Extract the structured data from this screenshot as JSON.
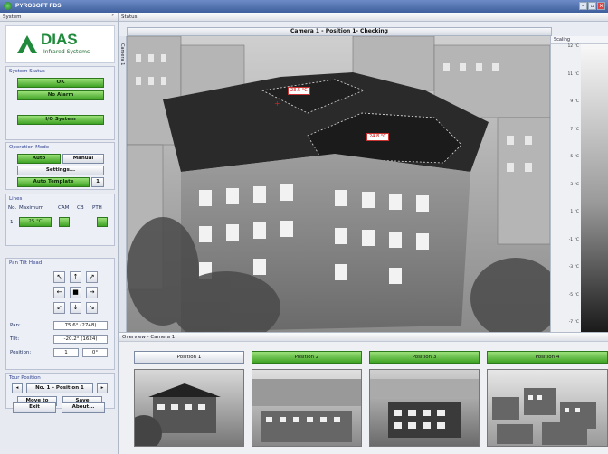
{
  "app": {
    "title": "PYROSOFT FDS"
  },
  "sidebar": {
    "header": "System",
    "logo": {
      "brand": "DIAS",
      "tagline": "Infrared Systems"
    },
    "system_status": {
      "title": "System Status",
      "ok": "OK",
      "alarm": "No Alarm",
      "io": "I/O System"
    },
    "operation_mode": {
      "title": "Operation Mode",
      "auto": "Auto",
      "manual": "Manual",
      "settings": "Settings...",
      "auto_template": "Auto Template",
      "template_no": "1"
    },
    "lines": {
      "title": "Lines",
      "headers": [
        "No.",
        "Maximum",
        "CAM",
        "CB",
        "PTH"
      ],
      "row": {
        "no": "1",
        "maximum": "25 °C"
      }
    },
    "pan_tilt": {
      "title": "Pan Tilt Head",
      "arrows": [
        "↖",
        "↑",
        "↗",
        "←",
        "■",
        "→",
        "↙",
        "↓",
        "↘"
      ],
      "pan_label": "Pan:",
      "pan_value": "75.6° (2748)",
      "tilt_label": "Tilt:",
      "tilt_value": "-20.2° (1624)",
      "position_label": "Position:",
      "position_value": "1",
      "position_deg": "0°"
    },
    "tour": {
      "title": "Tour Position",
      "prev": "◂",
      "current": "No. 1 – Position 1",
      "next": "▸",
      "move_to": "Move to",
      "save": "Save"
    },
    "exit": "Exit",
    "about": "About..."
  },
  "main": {
    "header": "Status",
    "camera_tab": "Camera 1",
    "camera_title": "Camera 1 - Position 1- Checking",
    "measurements": [
      "23.5 °C",
      "24.8 °C"
    ],
    "scaling": {
      "title": "Scaling",
      "ticks": [
        "12 °C",
        "11 °C",
        "9 °C",
        "7 °C",
        "5 °C",
        "3 °C",
        "1 °C",
        "-1 °C",
        "-3 °C",
        "-5 °C",
        "-7 °C"
      ]
    },
    "overview": {
      "title": "Overview - Camera 1",
      "positions": [
        "Position 1",
        "Position 2",
        "Position 3",
        "Position 4"
      ]
    }
  },
  "colors": {
    "accent_green": "#3fa324",
    "title_blue": "#3f5f9c",
    "measure_red": "#cc0000"
  }
}
